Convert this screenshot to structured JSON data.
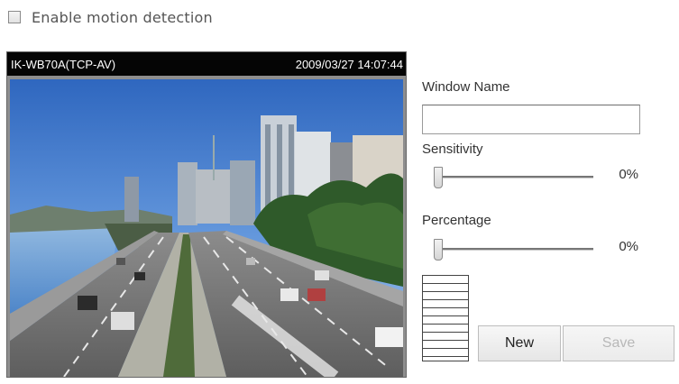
{
  "motion": {
    "enable_label": "Enable motion detection",
    "enabled": false
  },
  "camera": {
    "name": "IK-WB70A(TCP-AV)",
    "timestamp": "2009/03/27 14:07:44"
  },
  "window": {
    "name_label": "Window Name",
    "name_value": ""
  },
  "sensitivity": {
    "label": "Sensitivity",
    "value": "0%"
  },
  "percentage": {
    "label": "Percentage",
    "value": "0%"
  },
  "buttons": {
    "new_label": "New",
    "save_label": "Save"
  },
  "colors": {
    "header_bg": "#050505",
    "disabled_text": "#b8b8b8"
  }
}
